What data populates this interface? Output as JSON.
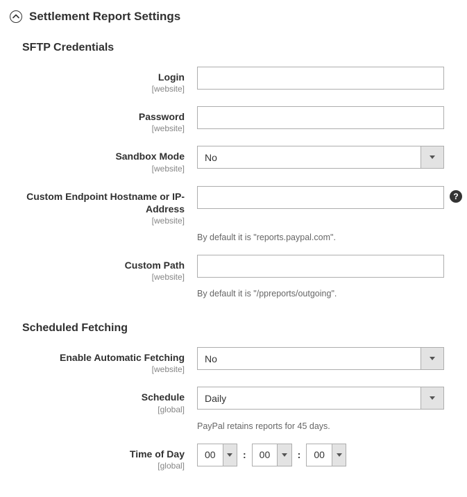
{
  "header": {
    "title": "Settlement Report Settings"
  },
  "sftp": {
    "group_title": "SFTP Credentials",
    "login": {
      "label": "Login",
      "scope": "[website]",
      "value": ""
    },
    "password": {
      "label": "Password",
      "scope": "[website]",
      "value": ""
    },
    "sandbox": {
      "label": "Sandbox Mode",
      "scope": "[website]",
      "value": "No"
    },
    "endpoint": {
      "label": "Custom Endpoint Hostname or IP-Address",
      "scope": "[website]",
      "value": "",
      "note": "By default it is \"reports.paypal.com\"."
    },
    "custom_path": {
      "label": "Custom Path",
      "scope": "[website]",
      "value": "",
      "note": "By default it is \"/ppreports/outgoing\"."
    }
  },
  "fetch": {
    "group_title": "Scheduled Fetching",
    "auto": {
      "label": "Enable Automatic Fetching",
      "scope": "[website]",
      "value": "No"
    },
    "schedule": {
      "label": "Schedule",
      "scope": "[global]",
      "value": "Daily",
      "note": "PayPal retains reports for 45 days."
    },
    "time": {
      "label": "Time of Day",
      "scope": "[global]",
      "hh": "00",
      "mm": "00",
      "ss": "00",
      "sep": ":"
    }
  }
}
